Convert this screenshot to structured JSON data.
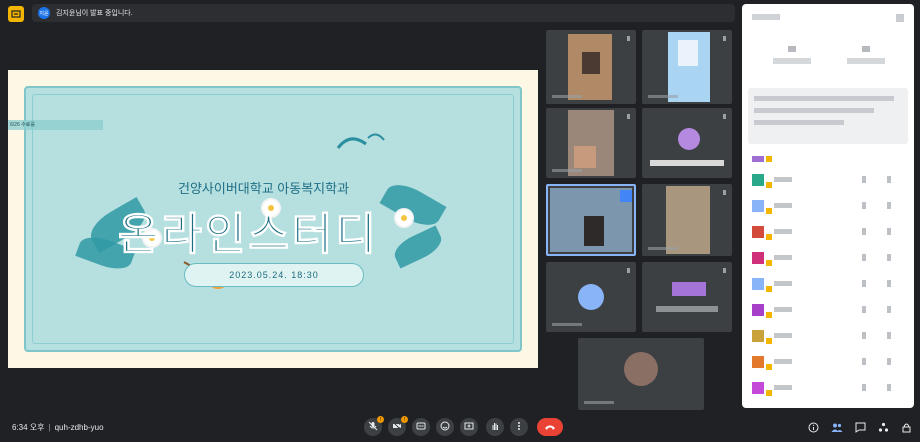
{
  "presentation": {
    "banner": "김지윤님이 발표 중입니다.",
    "avatar_initials": "지윤"
  },
  "slide": {
    "note": "6/26 수료를",
    "subtitle": "건양사이버대학교 아동복지학과",
    "title": "온라인스터디",
    "date": "2023.05.24. 18:30"
  },
  "meeting": {
    "time": "6:34 오후",
    "separator": "|",
    "code": "quh-zdhb-yuo"
  },
  "controls": {
    "mic_warning": "!",
    "cam_warning": "!"
  },
  "icons": {
    "present": "present-icon",
    "mic": "mic-off-icon",
    "camera": "camera-off-icon",
    "captions": "captions-icon",
    "emoji": "emoji-icon",
    "present_now": "present-now-icon",
    "hand": "raise-hand-icon",
    "more": "more-vert-icon",
    "hangup": "call-end-icon",
    "info": "info-icon",
    "people": "people-icon",
    "chat": "chat-icon",
    "activities": "activities-icon",
    "lock": "host-controls-icon"
  },
  "colors": {
    "background": "#202124",
    "accent": "#f2b500",
    "hangup": "#ea4335",
    "slide_teal": "#1a6f84"
  }
}
